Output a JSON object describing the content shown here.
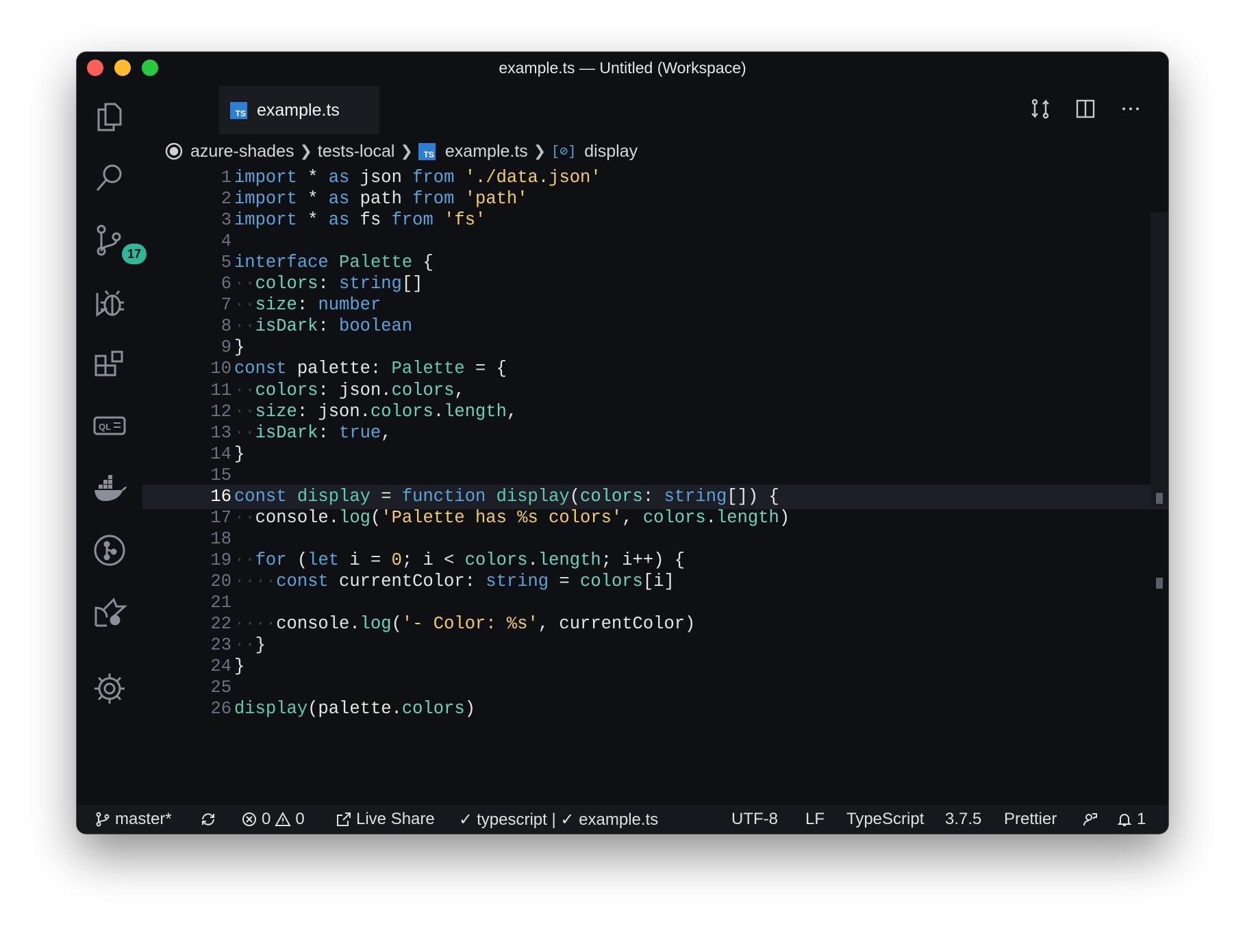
{
  "window": {
    "title": "example.ts — Untitled (Workspace)"
  },
  "activity_bar": {
    "icons": [
      "files-icon",
      "search-icon",
      "source-control-icon",
      "debug-icon",
      "extensions-icon",
      "ql-icon",
      "docker-icon",
      "git-graph-icon",
      "remote-icon",
      "settings-gear-icon"
    ],
    "source_control_badge": "17"
  },
  "tab": {
    "label": "example.ts",
    "file_icon": "TS"
  },
  "breadcrumb": {
    "root": "azure-shades",
    "folder": "tests-local",
    "file": "example.ts",
    "symbol": "display"
  },
  "editor": {
    "active_line": 16,
    "lines": [
      {
        "num": "1",
        "text": "import * as json from './data.json'"
      },
      {
        "num": "2",
        "text": "import * as path from 'path'"
      },
      {
        "num": "3",
        "text": "import * as fs from 'fs'"
      },
      {
        "num": "4",
        "text": ""
      },
      {
        "num": "5",
        "text": "interface Palette {"
      },
      {
        "num": "6",
        "text": "··colors: string[]"
      },
      {
        "num": "7",
        "text": "··size: number"
      },
      {
        "num": "8",
        "text": "··isDark: boolean"
      },
      {
        "num": "9",
        "text": "}"
      },
      {
        "num": "10",
        "text": "const palette: Palette = {"
      },
      {
        "num": "11",
        "text": "··colors: json.colors,"
      },
      {
        "num": "12",
        "text": "··size: json.colors.length,"
      },
      {
        "num": "13",
        "text": "··isDark: true,"
      },
      {
        "num": "14",
        "text": "}"
      },
      {
        "num": "15",
        "text": ""
      },
      {
        "num": "16",
        "text": "const display = function display(colors: string[]) {"
      },
      {
        "num": "17",
        "text": "··console.log('Palette has %s colors', colors.length)"
      },
      {
        "num": "18",
        "text": ""
      },
      {
        "num": "19",
        "text": "··for (let i = 0; i < colors.length; i++) {"
      },
      {
        "num": "20",
        "text": "····const currentColor: string = colors[i]"
      },
      {
        "num": "21",
        "text": ""
      },
      {
        "num": "22",
        "text": "····console.log('- Color: %s', currentColor)"
      },
      {
        "num": "23",
        "text": "··}"
      },
      {
        "num": "24",
        "text": "}"
      },
      {
        "num": "25",
        "text": ""
      },
      {
        "num": "26",
        "text": "display(palette.colors)"
      }
    ]
  },
  "statusbar": {
    "branch": "master*",
    "errors": "0",
    "warnings": "0",
    "live_share": "Live Share",
    "ts_check": "typescript | ✓ example.ts",
    "encoding": "UTF-8",
    "eol": "LF",
    "language": "TypeScript",
    "version": "3.7.5",
    "formatter": "Prettier",
    "notifications": "1"
  },
  "colors": {
    "background": "#0f1014",
    "keyword": "#5ba4d9",
    "type": "#5fcbb1",
    "string": "#f3cc6b",
    "badge": "#2fb79a"
  }
}
